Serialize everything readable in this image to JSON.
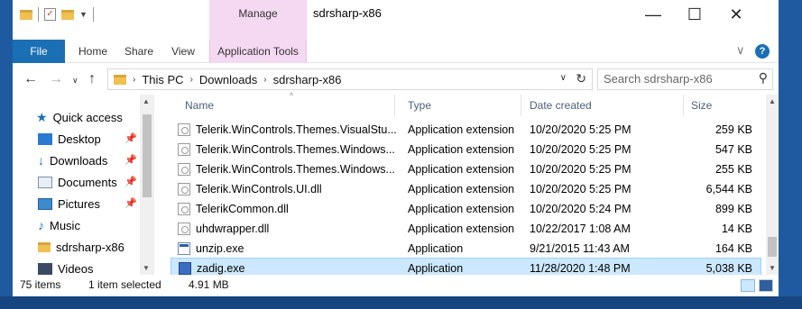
{
  "window": {
    "title": "sdrsharp-x86",
    "contextual_group": "Manage",
    "controls": {
      "minimize": "—",
      "maximize": "☐",
      "close": "✕"
    }
  },
  "ribbon": {
    "tabs": [
      "File",
      "Home",
      "Share",
      "View",
      "Application Tools"
    ],
    "collapse": "∨",
    "help": "?"
  },
  "nav": {
    "back": "←",
    "forward": "→",
    "recent": "∨",
    "up": "↑"
  },
  "address": {
    "path": [
      "This PC",
      "Downloads",
      "sdrsharp-x86"
    ],
    "separator": "›",
    "dropdown": "∨",
    "refresh": "↻"
  },
  "search": {
    "placeholder": "Search sdrsharp-x86",
    "icon": "⚲"
  },
  "sidebar": {
    "items": [
      {
        "label": "Quick access",
        "icon": "star-icon",
        "pinned": false
      },
      {
        "label": "Desktop",
        "icon": "desktop-icon",
        "pinned": true
      },
      {
        "label": "Downloads",
        "icon": "download-icon",
        "pinned": true
      },
      {
        "label": "Documents",
        "icon": "document-icon",
        "pinned": true
      },
      {
        "label": "Pictures",
        "icon": "picture-icon",
        "pinned": true
      },
      {
        "label": "Music",
        "icon": "music-icon",
        "pinned": false
      },
      {
        "label": "sdrsharp-x86",
        "icon": "folder-icon",
        "pinned": false
      },
      {
        "label": "Videos",
        "icon": "video-icon",
        "pinned": false
      }
    ],
    "pin_glyph": "📌"
  },
  "columns": {
    "name": "Name",
    "type": "Type",
    "date": "Date created",
    "size": "Size"
  },
  "files": [
    {
      "name": "Telerik.WinControls.Themes.VisualStu...",
      "type": "Application extension",
      "date": "10/20/2020 5:25 PM",
      "size": "259 KB",
      "icon": "dll",
      "selected": false
    },
    {
      "name": "Telerik.WinControls.Themes.Windows...",
      "type": "Application extension",
      "date": "10/20/2020 5:25 PM",
      "size": "547 KB",
      "icon": "dll",
      "selected": false
    },
    {
      "name": "Telerik.WinControls.Themes.Windows...",
      "type": "Application extension",
      "date": "10/20/2020 5:25 PM",
      "size": "255 KB",
      "icon": "dll",
      "selected": false
    },
    {
      "name": "Telerik.WinControls.UI.dll",
      "type": "Application extension",
      "date": "10/20/2020 5:25 PM",
      "size": "6,544 KB",
      "icon": "dll",
      "selected": false
    },
    {
      "name": "TelerikCommon.dll",
      "type": "Application extension",
      "date": "10/20/2020 5:24 PM",
      "size": "899 KB",
      "icon": "dll",
      "selected": false
    },
    {
      "name": "uhdwrapper.dll",
      "type": "Application extension",
      "date": "10/22/2017 1:08 AM",
      "size": "14 KB",
      "icon": "dll",
      "selected": false
    },
    {
      "name": "unzip.exe",
      "type": "Application",
      "date": "9/21/2015 11:43 AM",
      "size": "164 KB",
      "icon": "exe",
      "selected": false
    },
    {
      "name": "zadig.exe",
      "type": "Application",
      "date": "11/28/2020 1:48 PM",
      "size": "5,038 KB",
      "icon": "zadig",
      "selected": true
    }
  ],
  "status": {
    "items": "75 items",
    "selected": "1 item selected",
    "size": "4.91 MB"
  },
  "colors": {
    "accent": "#1a6fb5",
    "contextual": "#f5d8f2",
    "selection": "#cce8ff",
    "desktop": "#1b4f8f"
  }
}
